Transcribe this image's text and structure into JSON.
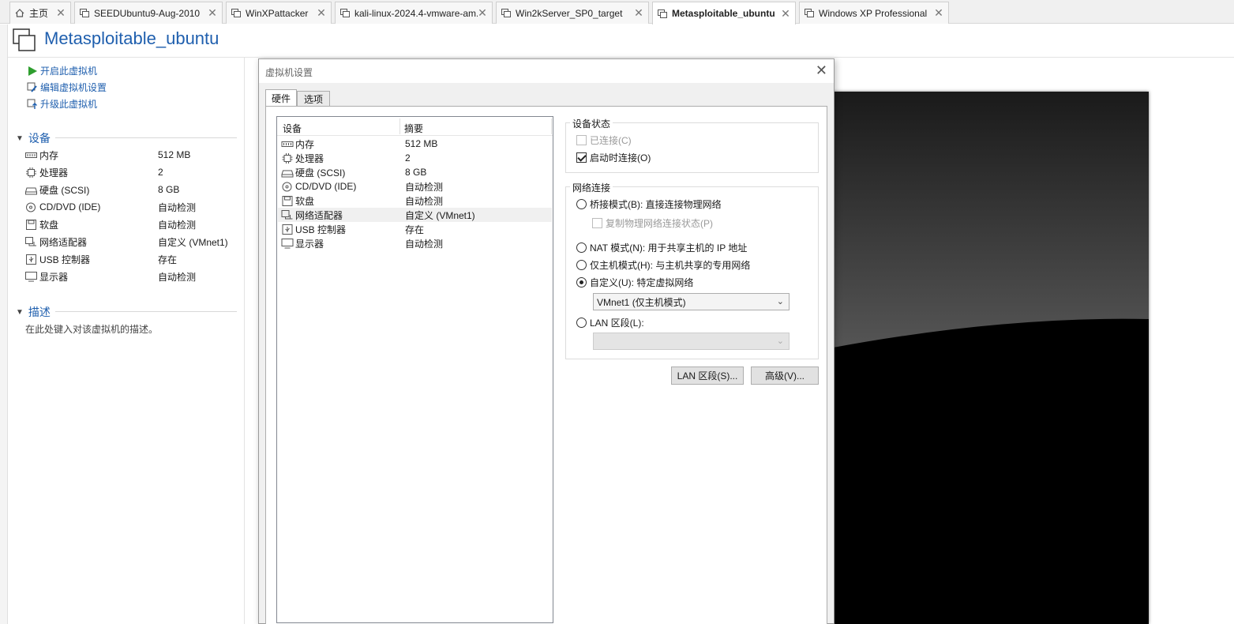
{
  "tabs": [
    {
      "label": "主页",
      "icon": "home-icon"
    },
    {
      "label": "SEEDUbuntu9-Aug-2010",
      "icon": "vm-icon"
    },
    {
      "label": "WinXPattacker",
      "icon": "vm-icon"
    },
    {
      "label": "kali-linux-2024.4-vmware-am...",
      "icon": "vm-icon"
    },
    {
      "label": "Win2kServer_SP0_target",
      "icon": "vm-icon"
    },
    {
      "label": "Metasploitable_ubuntu",
      "icon": "vm-icon"
    },
    {
      "label": "Windows XP Professional",
      "icon": "vm-icon"
    }
  ],
  "vm_title": "Metasploitable_ubuntu",
  "actions": {
    "power_on": "开启此虚拟机",
    "edit_settings": "编辑虚拟机设置",
    "upgrade": "升级此虚拟机"
  },
  "devices_section": {
    "title": "设备",
    "items": [
      {
        "name": "内存",
        "value": "512 MB",
        "icon": "memory-icon"
      },
      {
        "name": "处理器",
        "value": "2",
        "icon": "cpu-icon"
      },
      {
        "name": "硬盘 (SCSI)",
        "value": "8 GB",
        "icon": "harddisk-icon"
      },
      {
        "name": "CD/DVD (IDE)",
        "value": "自动检测",
        "icon": "cd-icon"
      },
      {
        "name": "软盘",
        "value": "自动检测",
        "icon": "floppy-icon"
      },
      {
        "name": "网络适配器",
        "value": "自定义 (VMnet1)",
        "icon": "network-icon"
      },
      {
        "name": "USB 控制器",
        "value": "存在",
        "icon": "usb-icon"
      },
      {
        "name": "显示器",
        "value": "自动检测",
        "icon": "monitor-icon"
      }
    ]
  },
  "description_section": {
    "title": "描述",
    "placeholder": "在此处键入对该虚拟机的描述。"
  },
  "dialog": {
    "title": "虚拟机设置",
    "tab_hardware": "硬件",
    "tab_options": "选项",
    "list_header_device": "设备",
    "list_header_summary": "摘要",
    "list": [
      {
        "name": "内存",
        "value": "512 MB",
        "icon": "memory-icon"
      },
      {
        "name": "处理器",
        "value": "2",
        "icon": "cpu-icon"
      },
      {
        "name": "硬盘 (SCSI)",
        "value": "8 GB",
        "icon": "harddisk-icon"
      },
      {
        "name": "CD/DVD (IDE)",
        "value": "自动检测",
        "icon": "cd-icon"
      },
      {
        "name": "软盘",
        "value": "自动检测",
        "icon": "floppy-icon"
      },
      {
        "name": "网络适配器",
        "value": "自定义 (VMnet1)",
        "icon": "network-icon",
        "selected": true
      },
      {
        "name": "USB 控制器",
        "value": "存在",
        "icon": "usb-icon"
      },
      {
        "name": "显示器",
        "value": "自动检测",
        "icon": "monitor-icon"
      }
    ],
    "device_status": {
      "title": "设备状态",
      "connected": "已连接(C)",
      "connect_on_power": "启动时连接(O)"
    },
    "network": {
      "title": "网络连接",
      "bridged": "桥接模式(B): 直接连接物理网络",
      "replicate": "复制物理网络连接状态(P)",
      "nat": "NAT 模式(N): 用于共享主机的 IP 地址",
      "host_only": "仅主机模式(H): 与主机共享的专用网络",
      "custom": "自定义(U): 特定虚拟网络",
      "custom_value": "VMnet1 (仅主机模式)",
      "lan": "LAN 区段(L):",
      "lan_value": ""
    },
    "btn_lan": "LAN 区段(S)...",
    "btn_advanced": "高级(V)..."
  }
}
